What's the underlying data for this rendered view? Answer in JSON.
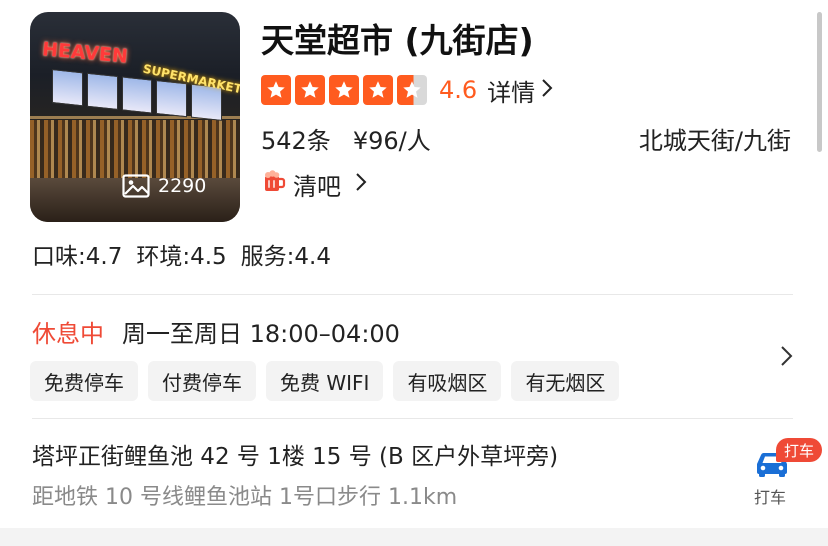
{
  "shop": {
    "name": "天堂超市 (九街店)",
    "photo": {
      "neon_sign": "HEAVEN",
      "neon_sign_2": "SUPERMARKET",
      "photo_count": "2290",
      "icon": "image-icon"
    },
    "rating": {
      "stars": 4.5,
      "score": "4.6",
      "detail_label": "详情"
    },
    "reviews": "542条",
    "price": "¥96/人",
    "area": "北城天街/九街",
    "category": {
      "icon": "beer-mug-icon",
      "label": "清吧"
    },
    "subscores": {
      "taste": "口味:4.7",
      "environment": "环境:4.5",
      "service": "服务:4.4"
    }
  },
  "hours": {
    "status": "休息中",
    "time": "周一至周日 18:00–04:00"
  },
  "facilities": [
    "免费停车",
    "付费停车",
    "免费 WIFI",
    "有吸烟区",
    "有无烟区"
  ],
  "location": {
    "address": "塔坪正街鲤鱼池 42 号 1楼 15 号 (B 区户外草坪旁)",
    "distance": "距地铁 10 号线鲤鱼池站 1号口步行 1.1km",
    "taxi_badge": "打车",
    "taxi_label": "打车"
  },
  "colors": {
    "accent": "#ff5b1f",
    "status_closed": "#ef4a36",
    "taxi_icon": "#1a6fd6"
  }
}
